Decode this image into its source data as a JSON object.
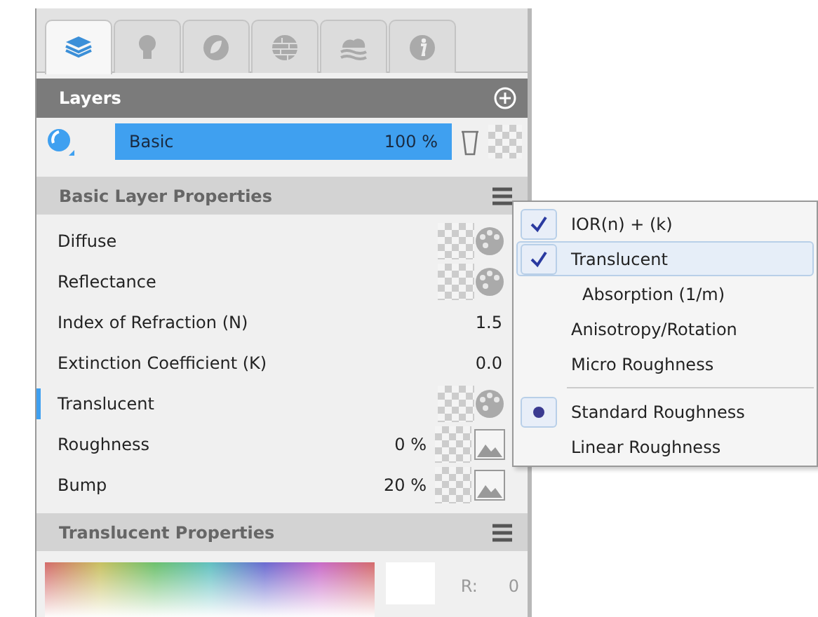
{
  "tabs": [
    {
      "kind": "layers",
      "selected": true
    },
    {
      "kind": "bulb",
      "selected": false
    },
    {
      "kind": "leaf",
      "selected": false
    },
    {
      "kind": "brick",
      "selected": false
    },
    {
      "kind": "wave",
      "selected": false
    },
    {
      "kind": "info",
      "selected": false
    }
  ],
  "layers": {
    "title": "Layers",
    "items": [
      {
        "name": "Basic",
        "percent": "100 %",
        "selected": true
      }
    ]
  },
  "basic_properties": {
    "title": "Basic Layer Properties",
    "rows": [
      {
        "label": "Diffuse",
        "kind": "texture",
        "selected": false
      },
      {
        "label": "Reflectance",
        "kind": "texture",
        "selected": false
      },
      {
        "label": "Index of Refraction (N)",
        "kind": "number",
        "value": "1.5",
        "selected": false
      },
      {
        "label": "Extinction Coefficient (K)",
        "kind": "number",
        "value": "0.0",
        "selected": false
      },
      {
        "label": "Translucent",
        "kind": "texture",
        "selected": true
      },
      {
        "label": "Roughness",
        "kind": "map",
        "value": "0 %",
        "selected": false
      },
      {
        "label": "Bump",
        "kind": "map",
        "value": "20 %",
        "selected": false
      }
    ]
  },
  "translucent_properties": {
    "title": "Translucent Properties",
    "channel_label": "R:",
    "channel_value": "0"
  },
  "menu": {
    "items": [
      {
        "label": "IOR(n) + (k)",
        "kind": "check",
        "checked": true,
        "highlighted": false
      },
      {
        "label": "Translucent",
        "kind": "check",
        "checked": true,
        "highlighted": true,
        "children": [
          {
            "label": "Absorption (1/m)",
            "highlighted": false
          }
        ]
      },
      {
        "label": "Anisotropy/Rotation",
        "kind": "check",
        "checked": false,
        "highlighted": false
      },
      {
        "label": "Micro Roughness",
        "kind": "check",
        "checked": false,
        "highlighted": false
      },
      {
        "kind": "separator"
      },
      {
        "label": "Standard Roughness",
        "kind": "radio",
        "checked": true,
        "highlighted": false
      },
      {
        "label": "Linear Roughness",
        "kind": "radio",
        "checked": false,
        "highlighted": false
      }
    ]
  }
}
